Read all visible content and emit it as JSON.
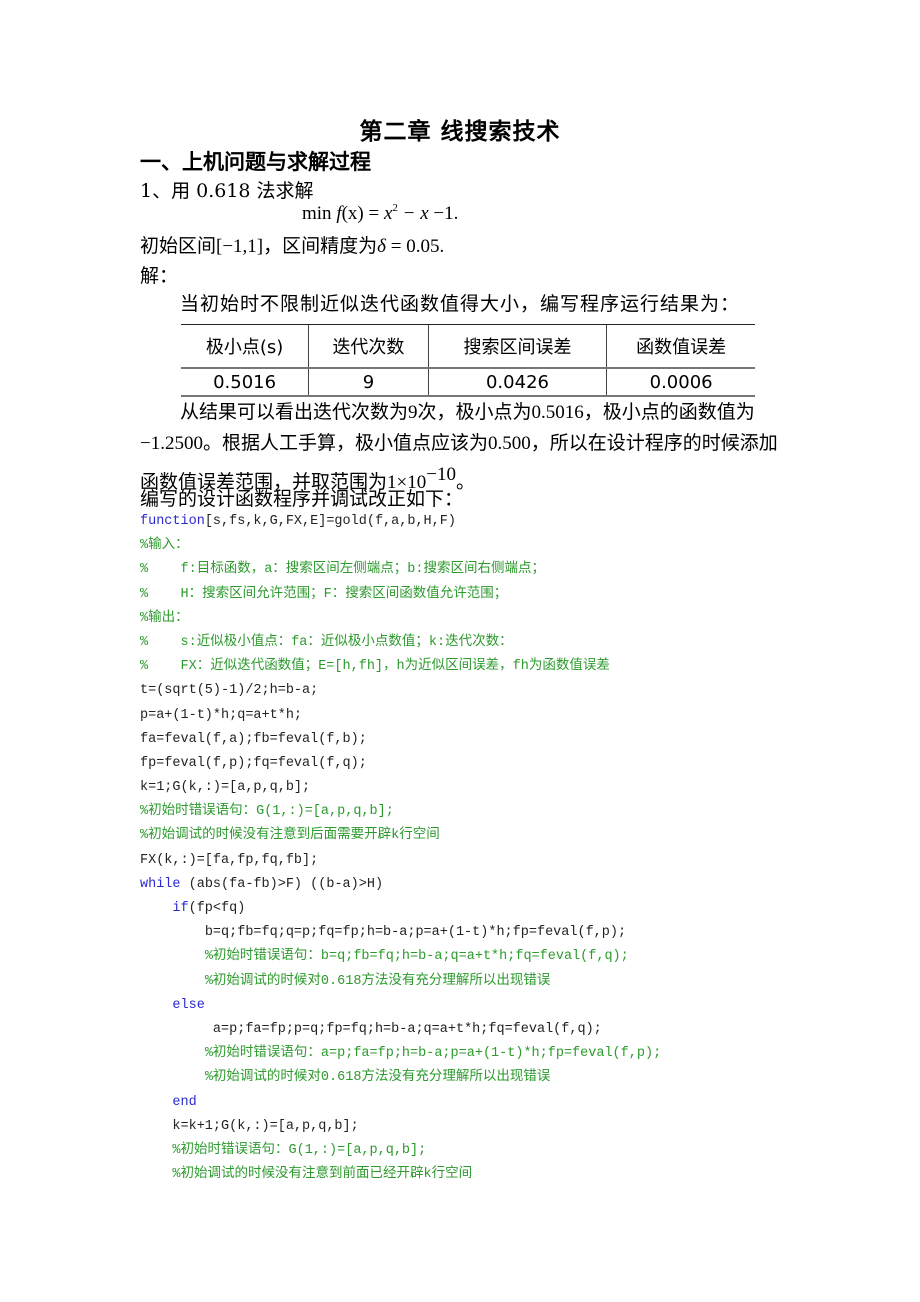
{
  "document": {
    "chapter_title": "第二章  线搜索技术",
    "section_heading": "一、上机问题与求解过程",
    "problem": {
      "statement": "1、用 0.618 法求解",
      "formula": {
        "prefix": "min ",
        "func": "f",
        "arg": "(x) = ",
        "var": "x",
        "exp": "2",
        "rest_var": " − x",
        "rest": " −1."
      },
      "interval_text_1": "初始区间",
      "interval": "[−1,1]",
      "interval_text_2": "，区间精度为",
      "delta": "δ",
      "delta_value": " = 0.05.",
      "solution_label": "解："
    },
    "intro_sentence": "当初始时不限制近似迭代函数值得大小，编写程序运行结果为：",
    "results_table": {
      "headers": [
        "极小点(s)",
        "迭代次数",
        "搜索区间误差",
        "函数值误差"
      ],
      "rows": [
        [
          "0.5016",
          "9",
          "0.0426",
          "0.0006"
        ]
      ]
    },
    "analysis": {
      "p1": "从结果可以看出迭代次数为",
      "iterations": "9",
      "p2": "次，极小点为",
      "min_point": "0.5016",
      "p3": "，极小点的函数值为",
      "min_value": "−1.2500",
      "p4": "。根据人工手算，极小值点应该为",
      "manual_value": "0.500",
      "p5": "，所以在设计程序的时候添加函数值误差范围，并取范围为",
      "tolerance_base": "1×10",
      "tolerance_exp": "−10",
      "p6": "。"
    },
    "code_intro": "编写的设计函数程序并调试改正如下：",
    "code_lines": [
      {
        "kw": "function",
        "text": "[s,fs,k,G,FX,E]=gold(f,a,b,H,F)",
        "comment": ""
      },
      {
        "kw": "",
        "text": "",
        "comment": "%输入："
      },
      {
        "kw": "",
        "text": "",
        "comment": "%    f:目标函数，a：搜索区间左侧端点；b:搜索区间右侧端点；"
      },
      {
        "kw": "",
        "text": "",
        "comment": "%    H：搜索区间允许范围；F：搜索区间函数值允许范围；"
      },
      {
        "kw": "",
        "text": "",
        "comment": "%输出："
      },
      {
        "kw": "",
        "text": "",
        "comment": "%    s:近似极小值点：fa：近似极小点数值；k:迭代次数："
      },
      {
        "kw": "",
        "text": "",
        "comment": "%    FX：近似迭代函数值；E=[h,fh]，h为近似区间误差，fh为函数值误差"
      },
      {
        "kw": "",
        "text": "t=(sqrt(5)-1)/2;h=b-a;",
        "comment": ""
      },
      {
        "kw": "",
        "text": "p=a+(1-t)*h;q=a+t*h;",
        "comment": ""
      },
      {
        "kw": "",
        "text": "fa=feval(f,a);fb=feval(f,b);",
        "comment": ""
      },
      {
        "kw": "",
        "text": "fp=feval(f,p);fq=feval(f,q);",
        "comment": ""
      },
      {
        "kw": "",
        "text": "k=1;G(k,:)=[a,p,q,b];",
        "comment": ""
      },
      {
        "kw": "",
        "text": "",
        "comment": "%初始时错误语句：G(1,:)=[a,p,q,b];"
      },
      {
        "kw": "",
        "text": "",
        "comment": "%初始调试的时候没有注意到后面需要开辟k行空间"
      },
      {
        "kw": "",
        "text": "FX(k,:)=[fa,fp,fq,fb];",
        "comment": ""
      },
      {
        "kw": "while",
        "text": " (abs(fa-fb)>F) ((b-a)>H)",
        "comment": ""
      },
      {
        "indent": "    ",
        "kw": "if",
        "text": "(fp<fq)",
        "comment": ""
      },
      {
        "indent": "        ",
        "kw": "",
        "text": "b=q;fb=fq;q=p;fq=fp;h=b-a;p=a+(1-t)*h;fp=feval(f,p);",
        "comment": ""
      },
      {
        "indent": "        ",
        "kw": "",
        "text": "",
        "comment": "%初始时错误语句：b=q;fb=fq;h=b-a;q=a+t*h;fq=feval(f,q);"
      },
      {
        "indent": "        ",
        "kw": "",
        "text": "",
        "comment": "%初始调试的时候对0.618方法没有充分理解所以出现错误"
      },
      {
        "indent": "    ",
        "kw": "else",
        "text": "",
        "comment": ""
      },
      {
        "indent": "         ",
        "kw": "",
        "text": "a=p;fa=fp;p=q;fp=fq;h=b-a;q=a+t*h;fq=feval(f,q);",
        "comment": ""
      },
      {
        "indent": "        ",
        "kw": "",
        "text": "",
        "comment": "%初始时错误语句：a=p;fa=fp;h=b-a;p=a+(1-t)*h;fp=feval(f,p);"
      },
      {
        "indent": "        ",
        "kw": "",
        "text": "",
        "comment": "%初始调试的时候对0.618方法没有充分理解所以出现错误"
      },
      {
        "indent": "    ",
        "kw": "end",
        "text": "",
        "comment": ""
      },
      {
        "indent": "    ",
        "kw": "",
        "text": "k=k+1;G(k,:)=[a,p,q,b];",
        "comment": ""
      },
      {
        "indent": "    ",
        "kw": "",
        "text": "",
        "comment": "%初始时错误语句：G(1,:)=[a,p,q,b];"
      },
      {
        "indent": "    ",
        "kw": "",
        "text": "",
        "comment": "%初始调试的时候没有注意到前面已经开辟k行空间"
      }
    ],
    "colors": {
      "keyword": "#2a2ad0",
      "comment": "#2c9a2c",
      "code": "#222222"
    }
  }
}
